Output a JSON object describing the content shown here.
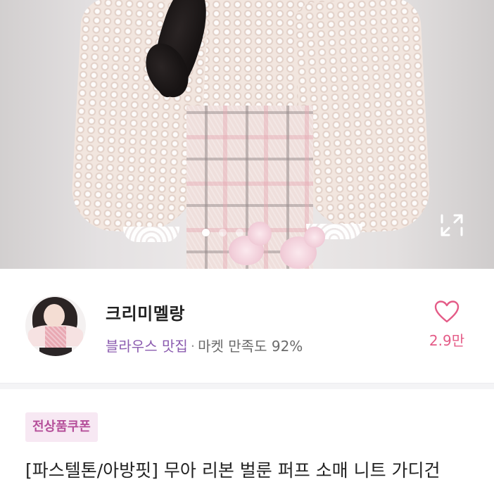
{
  "product_image": {
    "current_index": 1,
    "total_images": 3,
    "fullscreen_icon": "expand-arrows-icon"
  },
  "seller": {
    "name": "크리미멜랑",
    "tag": "블라우스 맛집",
    "separator": "·",
    "rating_text": "마켓 만족도 92%",
    "likes": "2.9만",
    "like_icon": "heart-outline-icon"
  },
  "product": {
    "coupon_badge": "전상품쿠폰",
    "title": "[파스텔톤/아방핏] 무아 리본 벌룬 퍼프 소매 니트 가디건"
  },
  "colors": {
    "seller_tag": "#8c5db0",
    "like": "#e45b87",
    "coupon_text": "#b54f9a",
    "coupon_bg": "#f7e8f3"
  }
}
